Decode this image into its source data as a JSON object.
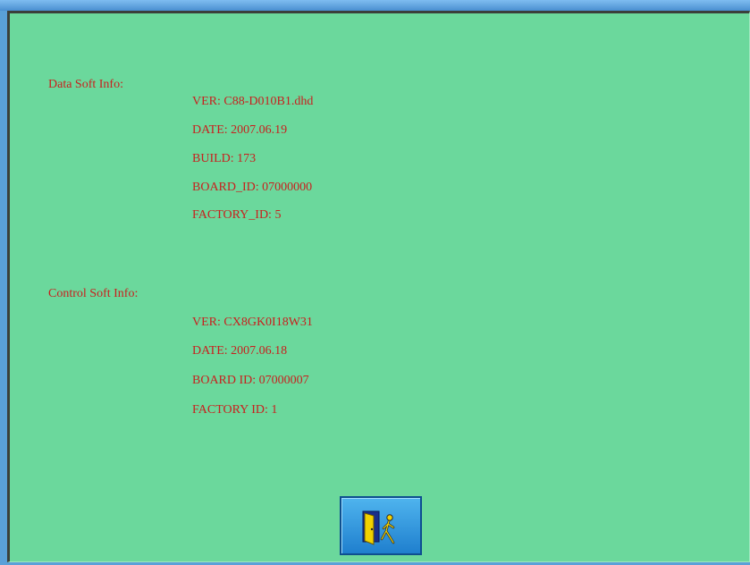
{
  "data_soft": {
    "heading": "Data Soft Info:",
    "ver": "VER: C88-D010B1.dhd",
    "date": "DATE: 2007.06.19",
    "build": "BUILD: 173",
    "board_id": "BOARD_ID: 07000000",
    "factory_id": "FACTORY_ID: 5"
  },
  "control_soft": {
    "heading": "Control Soft Info:",
    "ver": "VER: CX8GK0I18W31",
    "date": "DATE: 2007.06.18",
    "board_id": "BOARD ID: 07000007",
    "factory_id": "FACTORY ID: 1"
  },
  "exit_button": {
    "icon": "exit-door-icon"
  },
  "colors": {
    "background": "#6bd89c",
    "text": "#c8201e",
    "button": "#2a90dc",
    "frame": "#5aa0d8"
  }
}
